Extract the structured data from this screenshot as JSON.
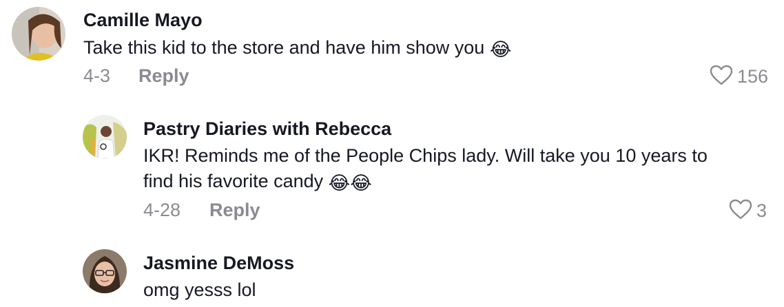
{
  "comments": [
    {
      "username": "Camille Mayo",
      "text": "Take this kid to the store and have him show you",
      "emoji": "😂",
      "date": "4-3",
      "reply_label": "Reply",
      "likes": "156",
      "icon": "heart-icon"
    },
    {
      "username": "Pastry Diaries with Rebecca",
      "text_line1": "IKR! Reminds me of the People Chips lady. Will take you 10 years to",
      "text_line2": "find his favorite candy",
      "emoji": "😂😂",
      "date": "4-28",
      "reply_label": "Reply",
      "likes": "3",
      "icon": "heart-icon"
    },
    {
      "username": "Jasmine DeMoss",
      "text": "omg yesss lol"
    }
  ]
}
